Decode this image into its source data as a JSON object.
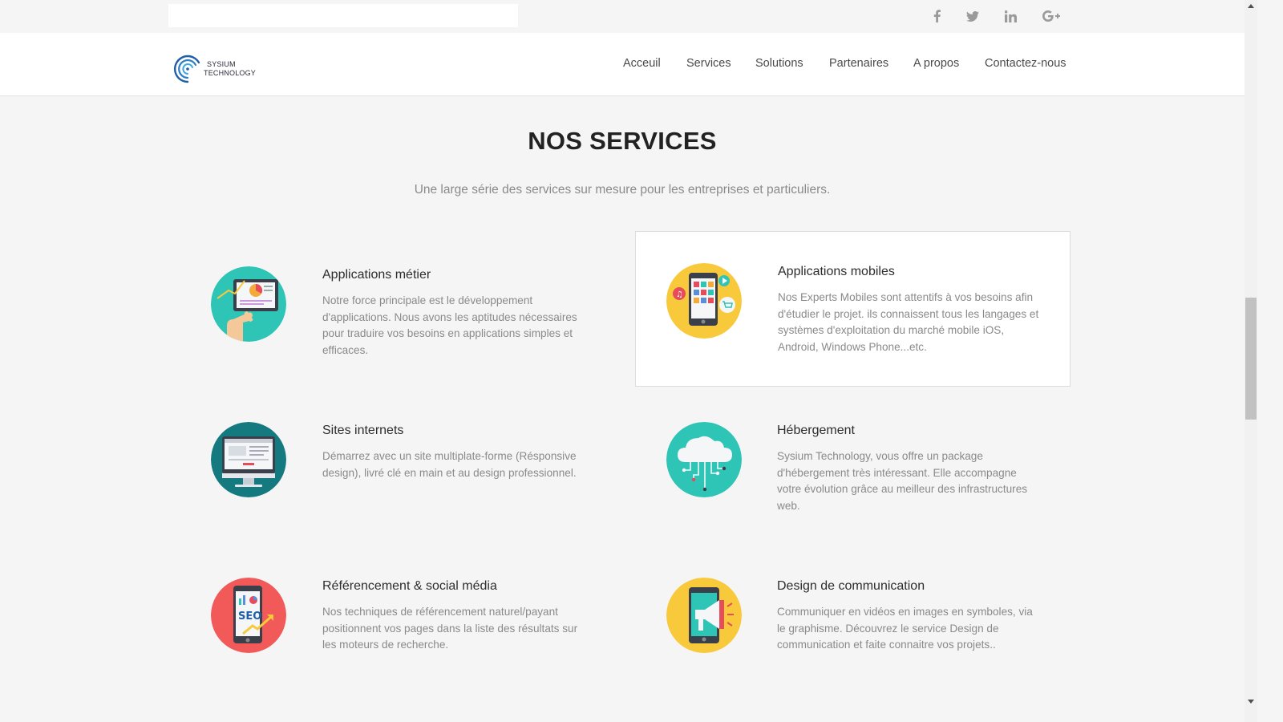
{
  "topbar": {
    "search_value": "",
    "social": [
      {
        "name": "facebook",
        "glyph": "f"
      },
      {
        "name": "twitter",
        "glyph": ""
      },
      {
        "name": "linkedin",
        "glyph": "in"
      },
      {
        "name": "google-plus",
        "glyph": "G+"
      }
    ]
  },
  "logo": {
    "line1": "SYSIUM",
    "line2": "TECHNOLOGY"
  },
  "nav": {
    "items": [
      "Acceuil",
      "Services",
      "Solutions",
      "Partenaires",
      "A propos",
      "Contactez-nous"
    ]
  },
  "section": {
    "title": "NOS SERVICES",
    "subtitle": "Une large série des services sur mesure pour les entreprises et particuliers."
  },
  "services": [
    {
      "title": "Applications métier",
      "desc": "Notre force principale est le développement d'applications. Nous avons les aptitudes nécessaires pour traduire vos besoins en applications simples et efficaces.",
      "icon": "tablet-chart-icon",
      "color": "#2ec4b6"
    },
    {
      "title": "Applications mobiles",
      "desc": "Nos Experts Mobiles sont attentifs à vos besoins afin d'étudier le projet. ils connaissent tous les langages et systèmes d'exploitation du marché mobile iOS, Android, Windows Phone...etc.",
      "icon": "smartphone-apps-icon",
      "color": "#f9c93c"
    },
    {
      "title": "Sites internets",
      "desc": "Démarrez avec un site multiplate-forme (Résponsive design), livré clé en main et au design professionnel.",
      "icon": "monitor-website-icon",
      "color": "#157a80"
    },
    {
      "title": "Hébergement",
      "desc": "Sysium Technology, vous offre un package d'hébergement très intéressant. Elle accompagne votre évolution grâce au meilleur des infrastructures web.",
      "icon": "cloud-hosting-icon",
      "color": "#2ec4b6"
    },
    {
      "title": "Référencement & social média",
      "desc": "Nos techniques de référencement naturel/payant positionnent vos pages dans la liste des résultats sur les moteurs de recherche.",
      "icon": "seo-phone-icon",
      "color": "#f25a5a",
      "icon_text": "SEO"
    },
    {
      "title": "Design de communication",
      "desc": "Communiquer en vidéos en images en symboles, via le graphisme. Découvrez le service Design de communication et faite connaitre vos projets..",
      "icon": "megaphone-phone-icon",
      "color": "#f9c93c"
    }
  ]
}
